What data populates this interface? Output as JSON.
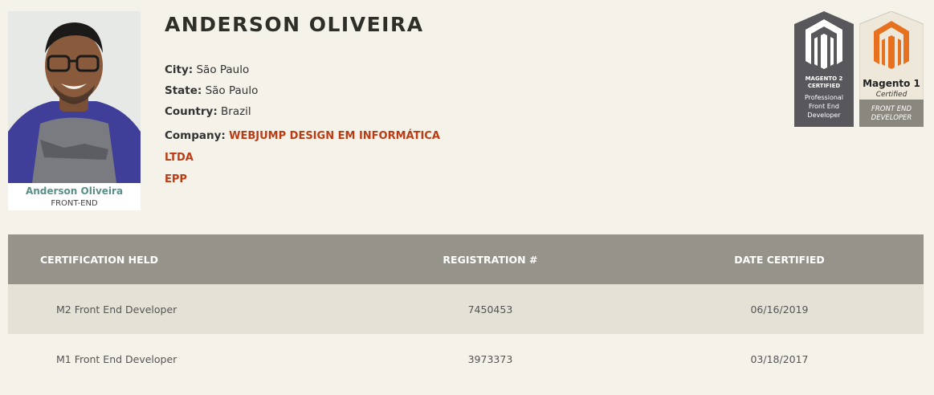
{
  "profile": {
    "name": "ANDERSON OLIVEIRA",
    "card_name": "Anderson Oliveira",
    "card_role": "FRONT-END",
    "city_label": "City:",
    "city": "São Paulo",
    "state_label": "State:",
    "state": "São Paulo",
    "country_label": "Country:",
    "country": "Brazil",
    "company_label": "Company:",
    "company_line1": "WEBJUMP DESIGN EM INFORMÁTICA LTDA",
    "company_line2": "EPP"
  },
  "badges": {
    "m2": {
      "line1": "MAGENTO 2",
      "line2": "CERTIFIED",
      "line3": "Professional",
      "line4": "Front End",
      "line5": "Developer",
      "icon": "magento-logo-icon"
    },
    "m1": {
      "line1": "Magento 1",
      "line2": "Certified",
      "line3": "FRONT END",
      "line4": "DEVELOPER",
      "icon": "magento-logo-icon"
    }
  },
  "table": {
    "headers": {
      "cert": "CERTIFICATION HELD",
      "reg": "REGISTRATION #",
      "date": "DATE CERTIFIED"
    },
    "rows": [
      {
        "cert": "M2 Front End Developer",
        "reg": "7450453",
        "date": "06/16/2019"
      },
      {
        "cert": "M1 Front End Developer",
        "reg": "3973373",
        "date": "03/18/2017"
      }
    ]
  },
  "colors": {
    "background": "#f5f2ea",
    "header_bg": "#96938a",
    "row_alt": "#e4e1d7",
    "company": "#bb3c14",
    "card_name": "#5a8f88",
    "magento_orange": "#e8711f"
  }
}
